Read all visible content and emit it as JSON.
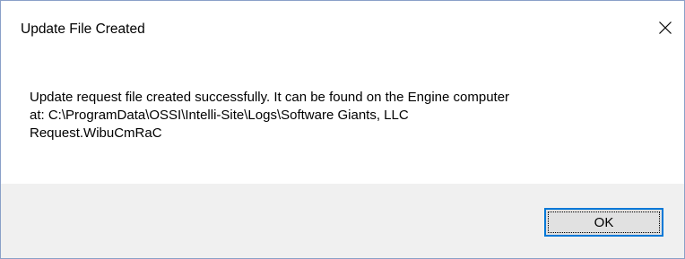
{
  "window": {
    "title": "Update File Created",
    "close_icon": "close-icon"
  },
  "message": {
    "text": "Update request file created successfully.  It can be found on the Engine computer\nat: C:\\ProgramData\\OSSI\\Intelli-Site\\Logs\\Software Giants, LLC\nRequest.WibuCmRaC"
  },
  "buttons": {
    "ok_label": "OK"
  },
  "colors": {
    "accent": "#0078d7",
    "footer_bg": "#f0f0f0",
    "button_bg": "#e1e1e1"
  }
}
